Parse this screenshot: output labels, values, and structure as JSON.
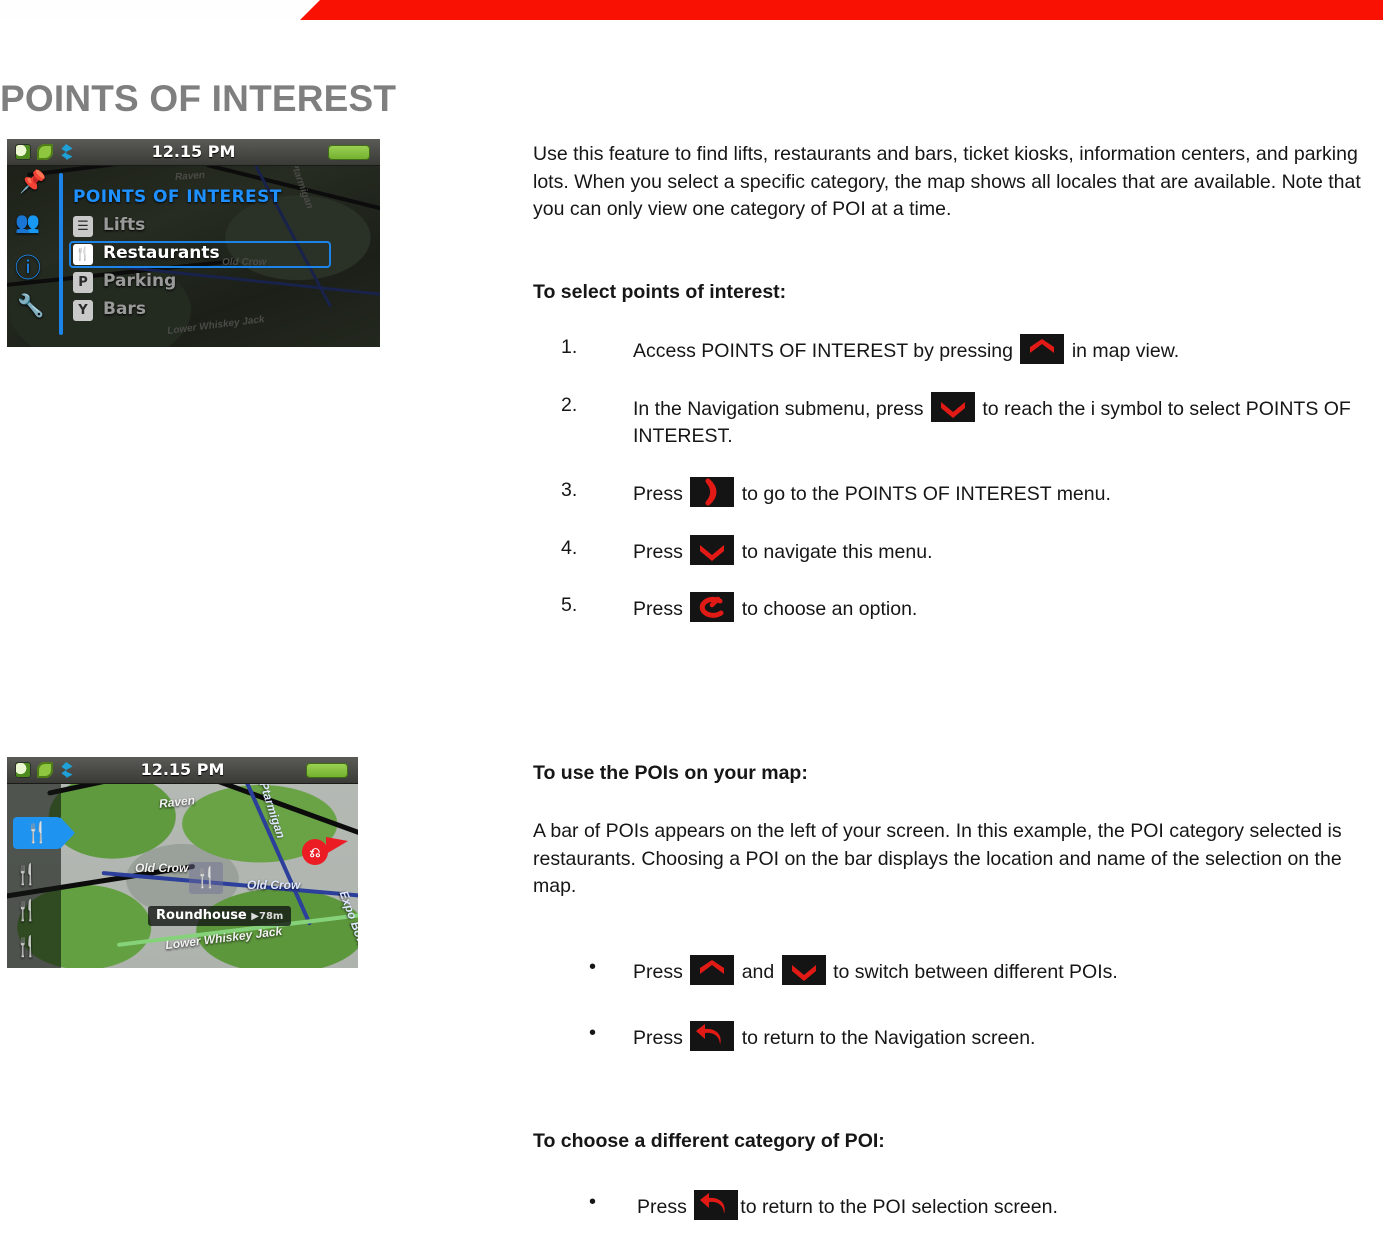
{
  "banner": {
    "color": "#f91103"
  },
  "page": {
    "title": "POINTS OF INTEREST",
    "title_color": "#7f7f7f"
  },
  "device_menu_screenshot": {
    "statusbar": {
      "time": "12.15 PM",
      "icons": [
        "phone-icon",
        "leaf-icon",
        "bluetooth-icon"
      ],
      "battery": "battery-full-icon"
    },
    "heading": "POINTS OF INTEREST",
    "side_icons": [
      "pin-icon",
      "people-icon",
      "info-icon",
      "wrench-icon"
    ],
    "items": [
      {
        "icon": "lift-icon",
        "glyph": "☰",
        "label": "Lifts",
        "selected": false
      },
      {
        "icon": "restaurant-icon",
        "glyph": "ἷ4",
        "label": "Restaurants",
        "selected": true
      },
      {
        "icon": "parking-icon",
        "glyph": "P",
        "label": "Parking",
        "selected": false
      },
      {
        "icon": "bar-icon",
        "glyph": "Y",
        "label": "Bars",
        "selected": false
      }
    ],
    "map_labels": [
      "Raven",
      "Old Crow",
      "Lower Whiskey Jack",
      "Ptarmigan"
    ]
  },
  "device_map_screenshot": {
    "statusbar": {
      "time": "12.15 PM",
      "icons": [
        "phone-icon",
        "leaf-icon",
        "bluetooth-icon"
      ],
      "battery": "battery-full-icon"
    },
    "poi_bar": {
      "selected_icon": "restaurant-icon",
      "other_icons": [
        "restaurant-icon",
        "restaurant-icon",
        "restaurant-icon"
      ]
    },
    "callout": {
      "name": "Roundhouse",
      "distance": "78m"
    },
    "map_labels": [
      "Raven",
      "Ptarmigan",
      "Old Crow",
      "Old Crow",
      "Lower Whiskey Jack",
      "Expo Bowl"
    ]
  },
  "intro": {
    "paragraph": "Use this feature to find lifts, restaurants and bars, ticket kiosks, information centers, and parking lots. When you select a specific category, the map shows all locales that are available. Note that you can only view one category of POI at a time.",
    "subheading": "To select points of interest:"
  },
  "steps": [
    {
      "number": "1.",
      "before": "Access POINTS OF INTEREST by pressing",
      "key": "chevron-up-key",
      "after": "in map view.",
      "after2": ""
    },
    {
      "number": "2.",
      "before": "In the Navigation submenu, press",
      "key": "chevron-down-key",
      "after": "to reach the i symbol to select",
      "after2": "POINTS OF INTEREST."
    },
    {
      "number": "3.",
      "before": "Press",
      "key": "chevron-right-key",
      "after": "to go to the POINTS OF INTEREST menu.",
      "after2": ""
    },
    {
      "number": "4.",
      "before": "Press",
      "key": "chevron-down-key",
      "after": "to navigate this menu.",
      "after2": ""
    },
    {
      "number": "5.",
      "before": "Press",
      "key": "power-select-key",
      "after": "to choose an option.",
      "after2": ""
    }
  ],
  "map_section": {
    "subheading": "To use the POIs on your map:",
    "paragraph": "A bar of POIs appears on the left of your screen. In this example, the POI category selected is restaurants. Choosing a POI on the bar displays the location and name of the selection on the map.",
    "bullets": [
      {
        "before": "Press",
        "key": "chevron-up-key",
        "middle": "and",
        "key2": "chevron-down-key",
        "after": "to switch between different POIs."
      },
      {
        "before": "Press",
        "key": "back-arrow-key",
        "middle": "",
        "key2": "",
        "after": "to return to the Navigation screen."
      }
    ]
  },
  "category_section": {
    "subheading": "To choose a different category of POI:",
    "bullets": [
      {
        "before": "Press",
        "key": "back-arrow-key",
        "after": "to return to the POI selection screen."
      }
    ]
  },
  "colors": {
    "key_background": "#141414",
    "key_glyph": "#e21a16",
    "device_accent_blue": "#1c84e8",
    "poi_selected_blue": "#1e93f0"
  }
}
